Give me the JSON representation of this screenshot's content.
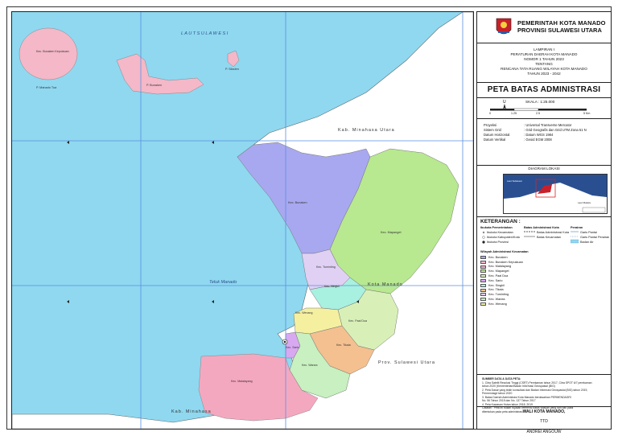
{
  "header": {
    "line1": "PEMERINTAH KOTA MANADO",
    "line2": "PROVINSI SULAWESI UTARA"
  },
  "lampiran": {
    "line1": "LAMPIRAN I",
    "line2": "PERATURAN DAERAH KOTA MANADO",
    "line3": "NOMOR 1 TAHUN 2023",
    "line4": "TENTANG",
    "line5": "RENCANA TATA RUANG WILAYAH KOTA MANADO",
    "line6": "TAHUN 2023 - 2042"
  },
  "map_title": "PETA BATAS ADMINISTRASI",
  "scale": {
    "label": "SKALA : 1:25.000",
    "ticks": [
      "0",
      "1.25",
      "2.5",
      "5 Km"
    ]
  },
  "projection": [
    {
      "k": "Proyeksi",
      "v": ": Universal Transverse Mercator"
    },
    {
      "k": "Sistem Grid",
      "v": ": Grid Geografis dan Grid UTM Zona 51 N"
    },
    {
      "k": "Datum Horizontal",
      "v": ": Datum WGS 1984"
    },
    {
      "k": "Datum Vertikal",
      "v": ": Geoid EGM 2008"
    }
  ],
  "diagram": {
    "title": "DIAGRAM LOKASI",
    "sea_label": "Laut Sulawesi",
    "sea2_label": "Laut Maluku"
  },
  "legend": {
    "title": "KETERANGAN :",
    "col1_title": "Ibukota Pemerintahan",
    "col1_items": [
      "Ibukota Kecamatan",
      "Ibukota Kabupaten/Kota",
      "Ibukota Provinsi"
    ],
    "col2_title": "Batas Administrasi Kota",
    "col2_items": [
      "Batas Administrasi Kota",
      "Batas Kecamatan"
    ],
    "col3_title": "Perairan",
    "col3_items": [
      "Garis Pantai",
      "Garis Pantai Perairan",
      "Badan Air"
    ],
    "wilayah_title": "Wilayah Administrasi Kecamatan",
    "kecamatan": [
      {
        "name": "Kec. Bunaken",
        "color": "#a8a8f0"
      },
      {
        "name": "Kec. Bunaken Kepulauan",
        "color": "#f4b8c8"
      },
      {
        "name": "Kec. Malalayang",
        "color": "#f4a8c0"
      },
      {
        "name": "Kec. Mapanget",
        "color": "#b8e890"
      },
      {
        "name": "Kec. Paal Dua",
        "color": "#d8f0b8"
      },
      {
        "name": "Kec. Sario",
        "color": "#d8a8f0"
      },
      {
        "name": "Kec. Singkil",
        "color": "#a8f0e0"
      },
      {
        "name": "Kec. Tikala",
        "color": "#f4c090"
      },
      {
        "name": "Kec. Tuminting",
        "color": "#e0d0f4"
      },
      {
        "name": "Kec. Wanea",
        "color": "#c8f0c0"
      },
      {
        "name": "Kec. Wenang",
        "color": "#f4f0a0"
      }
    ]
  },
  "notes": {
    "l1": "SUMBER DATA & DATA PETA:",
    "l2": "1. Citra Satelit Resolusi Tinggi (CSRT) Perekaman tahun 2017, Citra SPOT 6/7 perekaman",
    "l3": "   tahun 2020 (Kementerian/Badan Informasi Geospasial (BIG)",
    "l4": "2. Peta Dasar yang telah konsultasi dan Badan Informasi Geospasial (BIG) tahun 2019,",
    "l5": "   Permendagri tahun 2020",
    "l6": "3. Batas Daerah Administrasi Kota Manado berdasarkan PERMENDAGRI",
    "l7": "   No. 56 Tahun 2015 dan No. 137 Tahun 2017",
    "l8": "4. Peta Kawasan Hutan tahun 2018, 2019",
    "l9": "Catatan : Peta ini bukan rujukan referensi batas wilayah yang sah dan pasti",
    "l10": "   ditentukan pada peta administrasi"
  },
  "signature": {
    "title": "WALI KOTA MANADO,",
    "ttd": "TTD",
    "name": "ANDREI ANGOUW"
  },
  "map_labels": {
    "sea_north": "L A U T   S U L A W E S I",
    "bay": "Teluk Manado",
    "kab_minahasa_utara": "Kab. Minahasa Utara",
    "kota_manado": "Kota Manado",
    "prov_sulut": "Prov. Sulawesi Utara",
    "kab_minahasa": "Kab. Minahasa",
    "island1": "Kec. Bunaken Kepulauan",
    "p_manado_tua": "P. Manado Tua",
    "p_bunaken": "P. Bunaken",
    "p_siladen": "P. Siladen",
    "kec_bunaken": "Kec. Bunaken",
    "kec_mapanget": "Kec. Mapanget",
    "kec_tuminting": "Kec. Tuminting",
    "kec_singkil": "Kec. Singkil",
    "kec_wenang": "Kec. Wenang",
    "kec_paal_dua": "Kec. Paal Dua",
    "kec_sario": "Kec. Sario",
    "kec_tikala": "Kec. Tikala",
    "kec_wanea": "Kec. Wanea",
    "kec_malalayang": "Kec. Malalayang"
  },
  "colors": {
    "sea": "#8fd8f0",
    "land_outside": "#ffffff",
    "bunaken": "#a8a8f0",
    "mapanget": "#b8e890",
    "malalayang": "#f4a8c0",
    "islands": "#f4b8c8",
    "grid": "#5a8fe0"
  }
}
